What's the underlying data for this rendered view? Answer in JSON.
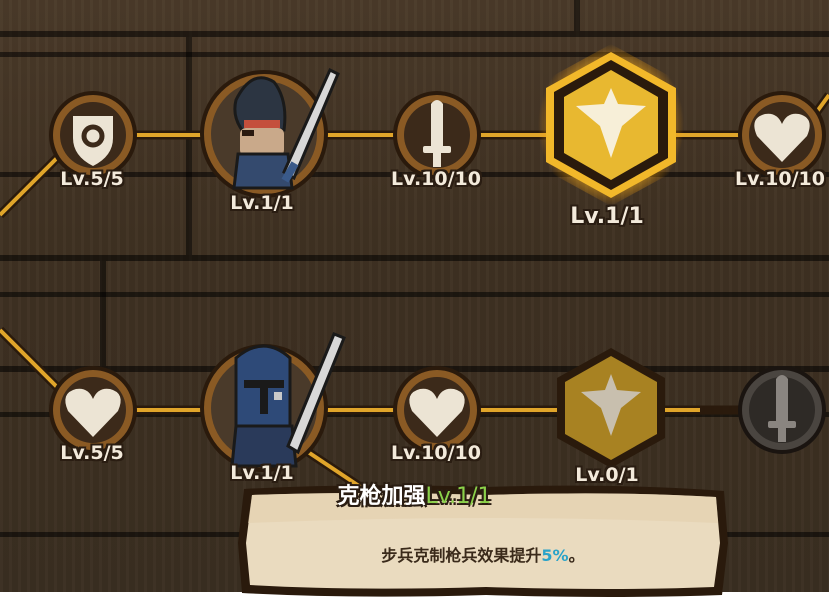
{
  "row1": {
    "nodes": [
      {
        "kind": "shield-target",
        "label": "Lv.5/5",
        "state": "unlocked"
      },
      {
        "kind": "knight-helmet",
        "label": "Lv.1/1",
        "state": "unlocked"
      },
      {
        "kind": "sword",
        "label": "Lv.10/10",
        "state": "unlocked"
      },
      {
        "kind": "spear-emblem",
        "label": "Lv.1/1",
        "state": "selected"
      },
      {
        "kind": "heart",
        "label": "Lv.10/10",
        "state": "unlocked"
      }
    ]
  },
  "row2": {
    "nodes": [
      {
        "kind": "heart",
        "label": "Lv.5/5",
        "state": "unlocked"
      },
      {
        "kind": "knight-greathelm",
        "label": "Lv.1/1",
        "state": "unlocked"
      },
      {
        "kind": "heart",
        "label": "Lv.10/10",
        "state": "unlocked"
      },
      {
        "kind": "spear-emblem",
        "label": "Lv.0/1",
        "state": "available"
      },
      {
        "kind": "sword",
        "label": "",
        "state": "locked"
      }
    ]
  },
  "detail": {
    "title": "克枪加强",
    "level": "Lv.1/1",
    "desc_prefix": "步兵克制枪兵效果提升",
    "desc_value": "5%",
    "desc_suffix": "。"
  },
  "colors": {
    "path": "#e0a52a",
    "gold": "#e8b830",
    "frame": "#7a4e20",
    "wood": "#4a3a29"
  }
}
